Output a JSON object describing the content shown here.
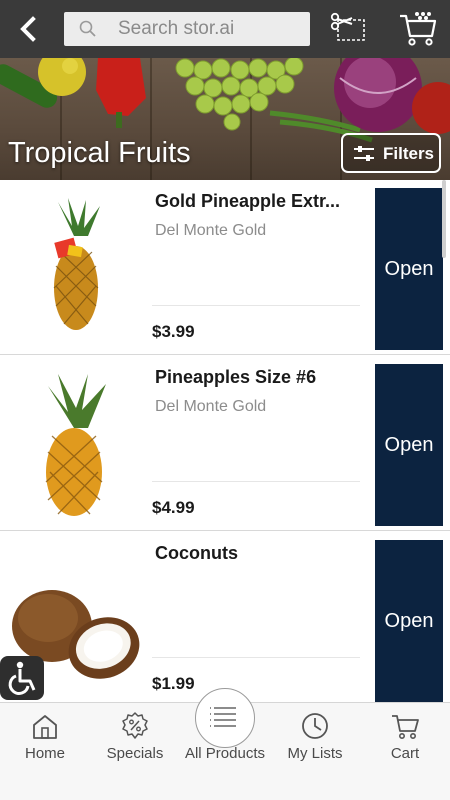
{
  "header": {
    "search_placeholder": "Search stor.ai",
    "icons": [
      "back-icon",
      "search-icon",
      "scissors-coupon-icon",
      "cart-icon"
    ]
  },
  "hero": {
    "title": "Tropical Fruits",
    "filters_label": "Filters"
  },
  "products": [
    {
      "name": "Gold Pineapple Extr...",
      "brand": "Del Monte Gold",
      "price": "$3.99",
      "action_label": "Open",
      "image": "pineapple-with-tag"
    },
    {
      "name": "Pineapples Size #6",
      "brand": "Del Monte Gold",
      "price": "$4.99",
      "action_label": "Open",
      "image": "pineapple"
    },
    {
      "name": "Coconuts",
      "brand": "",
      "price": "$1.99",
      "action_label": "Open",
      "image": "coconut"
    }
  ],
  "bottom_nav": {
    "items": [
      {
        "label": "Home",
        "icon": "home-icon"
      },
      {
        "label": "Specials",
        "icon": "specials-icon"
      },
      {
        "label": "All Products",
        "icon": "list-icon"
      },
      {
        "label": "My Lists",
        "icon": "clock-icon"
      },
      {
        "label": "Cart",
        "icon": "cart-icon"
      }
    ]
  },
  "colors": {
    "topbar": "#3a3a3a",
    "open_button": "#0c2340",
    "hero_wood": "#5a4a3c",
    "nav_background": "#f7f7f7"
  }
}
